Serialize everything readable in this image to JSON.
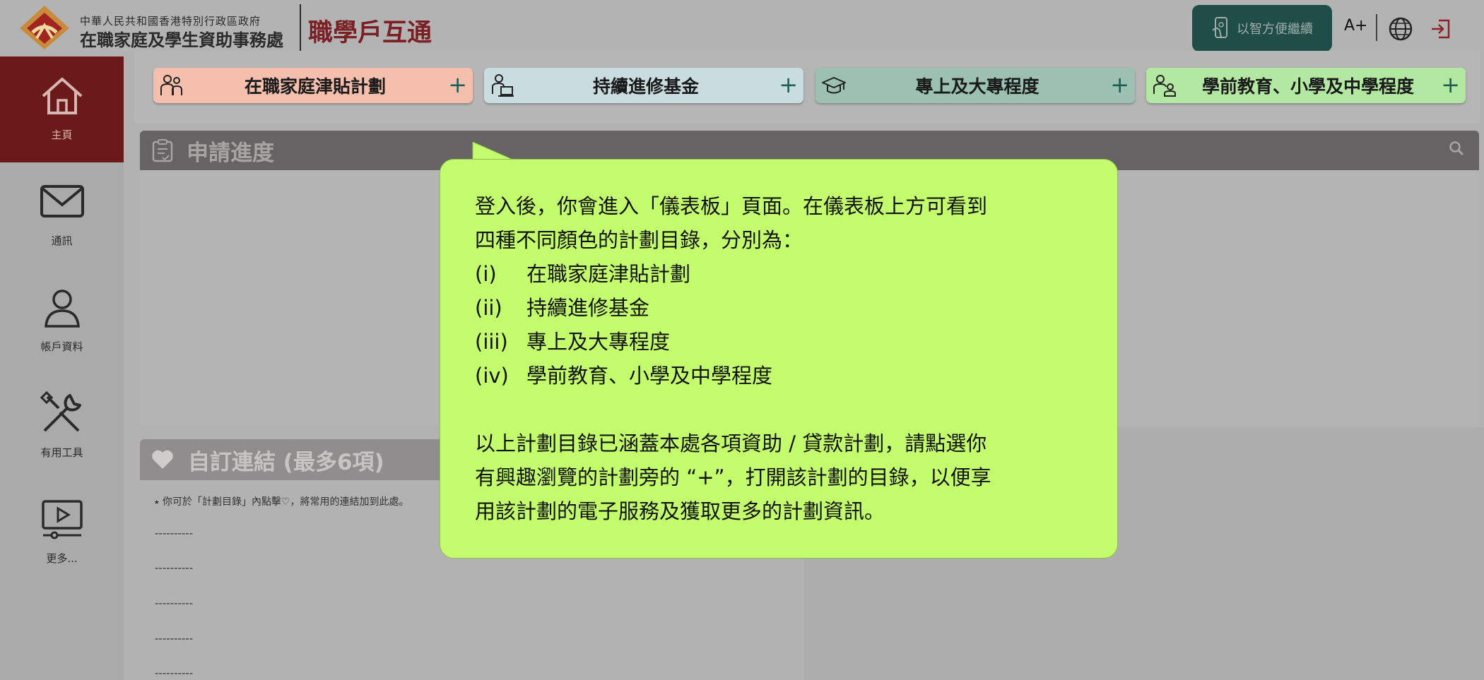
{
  "header": {
    "org_line1": "中華人民共和國香港特別行政區政府",
    "org_line2": "在職家庭及學生資助事務處",
    "brand": "職學戶互通",
    "smart_label": "以智方便繼續",
    "font_size_label": "A+"
  },
  "sidebar": {
    "items": [
      {
        "label": "主頁",
        "icon": "home-icon",
        "active": true
      },
      {
        "label": "通訊",
        "icon": "mail-icon"
      },
      {
        "label": "帳戶資料",
        "icon": "user-icon"
      },
      {
        "label": "有用工具",
        "icon": "tools-icon"
      },
      {
        "label": "更多...",
        "icon": "video-icon"
      }
    ]
  },
  "categories": [
    {
      "label": "在職家庭津貼計劃",
      "color": "#f5bfae",
      "icon": "family-icon"
    },
    {
      "label": "持續進修基金",
      "color": "#c9dde0",
      "icon": "study-icon"
    },
    {
      "label": "專上及大專程度",
      "color": "#9cc0b2",
      "icon": "graduation-cap-icon"
    },
    {
      "label": "學前教育、小學及中學程度",
      "color": "#b2e8a1",
      "icon": "children-icon"
    }
  ],
  "plus": "+",
  "progress": {
    "title": "申請進度"
  },
  "links": {
    "title": "自訂連結 (最多6項)",
    "hint": "⭑ 你可於「計劃目錄」內點擊♡，將常用的連結加到此處。",
    "placeholders": [
      "----------",
      "----------",
      "----------",
      "----------",
      "----------"
    ]
  },
  "tooltip": {
    "line1": "登入後，你會進入「儀表板」頁面。在儀表板上方可看到",
    "line2": "四種不同顏色的計劃目錄，分別為：",
    "items": [
      {
        "num": "(i)",
        "text": "在職家庭津貼計劃"
      },
      {
        "num": "(ii)",
        "text": "持續進修基金"
      },
      {
        "num": "(iii)",
        "text": "專上及大專程度"
      },
      {
        "num": "(iv)",
        "text": "學前教育、小學及中學程度"
      }
    ],
    "para2_line1": "以上計劃目錄已涵蓋本處各項資助 / 貸款計劃，請點選你",
    "para2_line2": "有興趣瀏覽的計劃旁的 “+”，打開該計劃的目錄，以便享",
    "para2_line3": "用該計劃的電子服務及獲取更多的計劃資訊。"
  },
  "colors": {
    "accent": "#6a1a19",
    "brand": "#7a1f24",
    "tooltip": "#c3fd6e",
    "smart": "#1f4d48"
  }
}
